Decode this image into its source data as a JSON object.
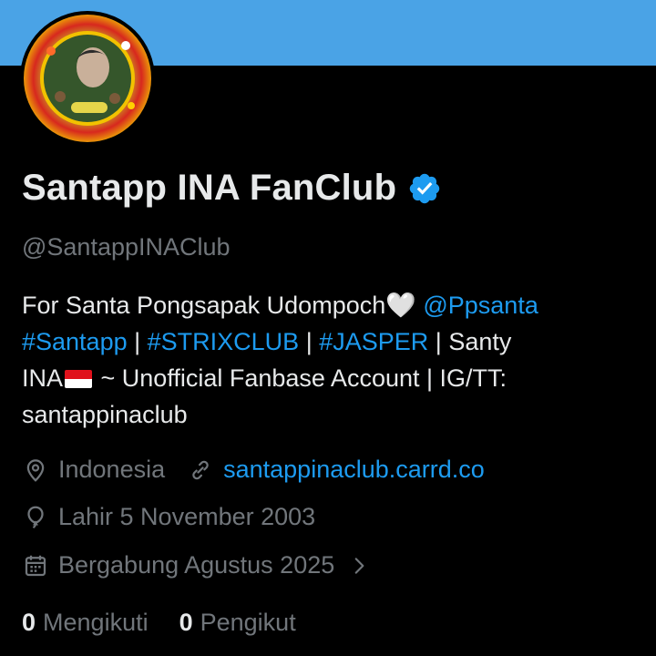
{
  "profile": {
    "name": "Santapp INA FanClub",
    "handle": "@SantappINAClub",
    "bio": {
      "line1_text": "For Santa Pongsapak Udompoch🤍 ",
      "line1_mention": "@Ppsanta",
      "hashtag1": "#Santapp",
      "sep1": " | ",
      "hashtag2": "#STRIXCLUB",
      "sep2": " | ",
      "hashtag3": "#JASPER",
      "line2_tail": " | Santy",
      "line3_start": "INA",
      "line3_end": " ~ Unofficial Fanbase Account | IG/TT:",
      "line4": "santappinaclub"
    },
    "location": "Indonesia",
    "website": "santappinaclub.carrd.co",
    "birthday": "Lahir 5 November 2003",
    "joined": "Bergabung Agustus 2025",
    "following_count": "0",
    "following_label": "Mengikuti",
    "followers_count": "0",
    "followers_label": "Pengikut"
  },
  "colors": {
    "banner": "#4aa3e6",
    "background": "#000000",
    "link": "#1d9bf0",
    "muted": "#71767b",
    "text": "#e7e9ea"
  },
  "icons": [
    "verified-badge-icon",
    "location-pin-icon",
    "link-icon",
    "balloon-icon",
    "calendar-icon",
    "chevron-right-icon",
    "indonesia-flag-icon"
  ]
}
